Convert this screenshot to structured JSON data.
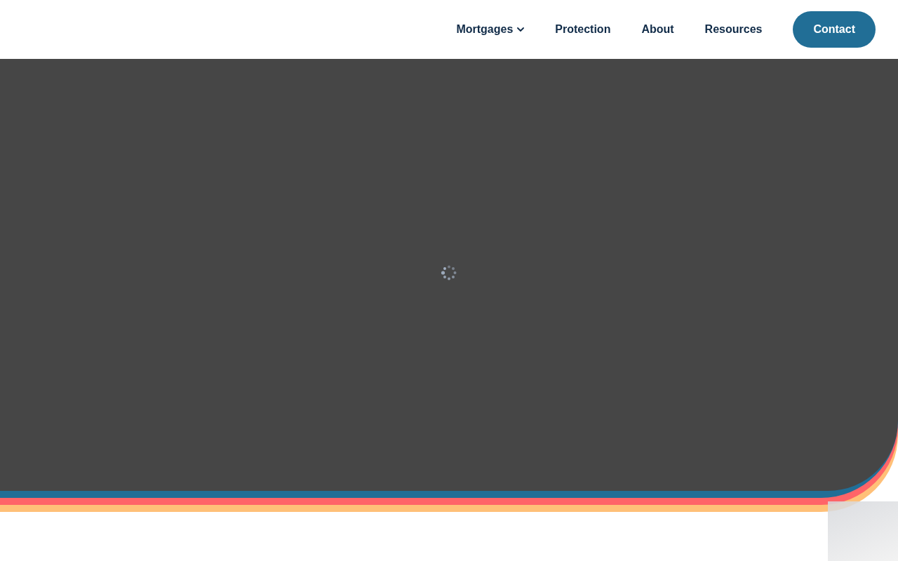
{
  "nav": {
    "items": [
      {
        "label": "Mortgages",
        "kind": "dropdown"
      },
      {
        "label": "Protection",
        "kind": "link"
      },
      {
        "label": "About",
        "kind": "link"
      },
      {
        "label": "Resources",
        "kind": "link"
      }
    ],
    "contact_button": {
      "label": "Contact"
    }
  },
  "hero": {
    "loading": true
  }
}
